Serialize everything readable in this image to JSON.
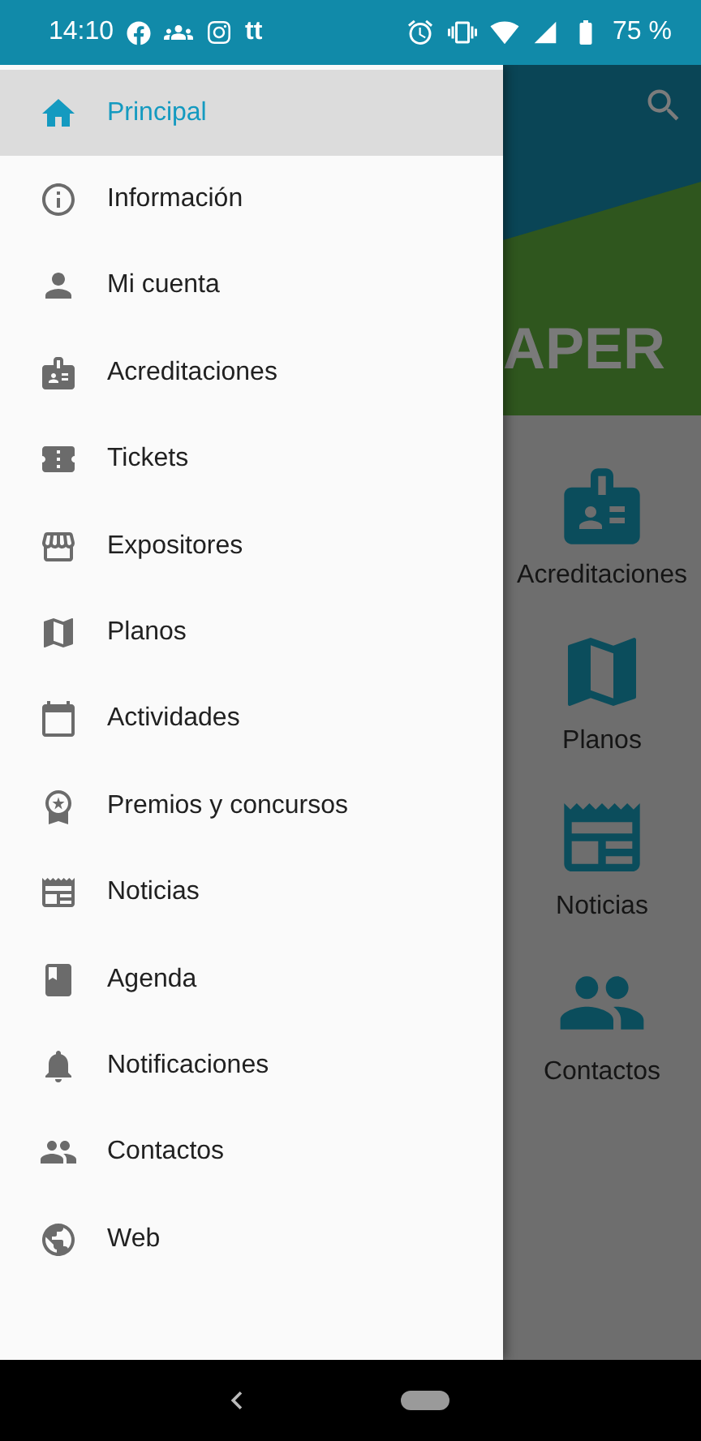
{
  "status_bar": {
    "time": "14:10",
    "app_badge": "tt",
    "battery": "75 %"
  },
  "drawer": {
    "items": [
      {
        "label": "Principal",
        "selected": true
      },
      {
        "label": "Información",
        "selected": false
      },
      {
        "label": "Mi cuenta",
        "selected": false
      },
      {
        "label": "Acreditaciones",
        "selected": false
      },
      {
        "label": "Tickets",
        "selected": false
      },
      {
        "label": "Expositores",
        "selected": false
      },
      {
        "label": "Planos",
        "selected": false
      },
      {
        "label": "Actividades",
        "selected": false
      },
      {
        "label": "Premios y concursos",
        "selected": false
      },
      {
        "label": "Noticias",
        "selected": false
      },
      {
        "label": "Agenda",
        "selected": false
      },
      {
        "label": "Notificaciones",
        "selected": false
      },
      {
        "label": "Contactos",
        "selected": false
      },
      {
        "label": "Web",
        "selected": false
      }
    ]
  },
  "background": {
    "logo_text": "APER",
    "tiles": [
      "Acreditaciones",
      "Planos",
      "Noticias",
      "Contactos"
    ]
  }
}
